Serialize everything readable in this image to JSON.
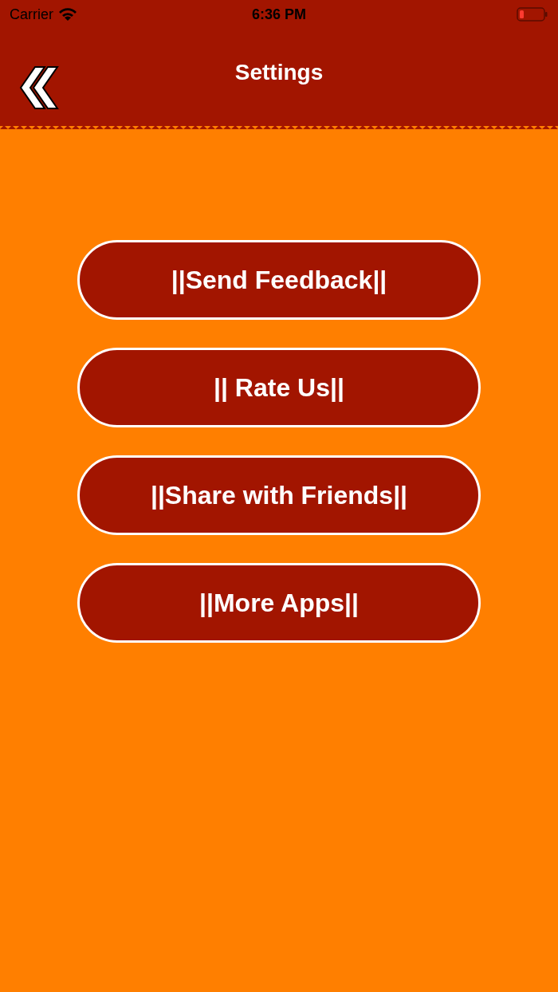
{
  "status_bar": {
    "carrier": "Carrier",
    "time": "6:36 PM"
  },
  "header": {
    "title": "Settings"
  },
  "buttons": [
    {
      "label": "||Send Feedback||"
    },
    {
      "label": "|| Rate Us||"
    },
    {
      "label": "||Share with Friends||"
    },
    {
      "label": "||More Apps||"
    }
  ]
}
